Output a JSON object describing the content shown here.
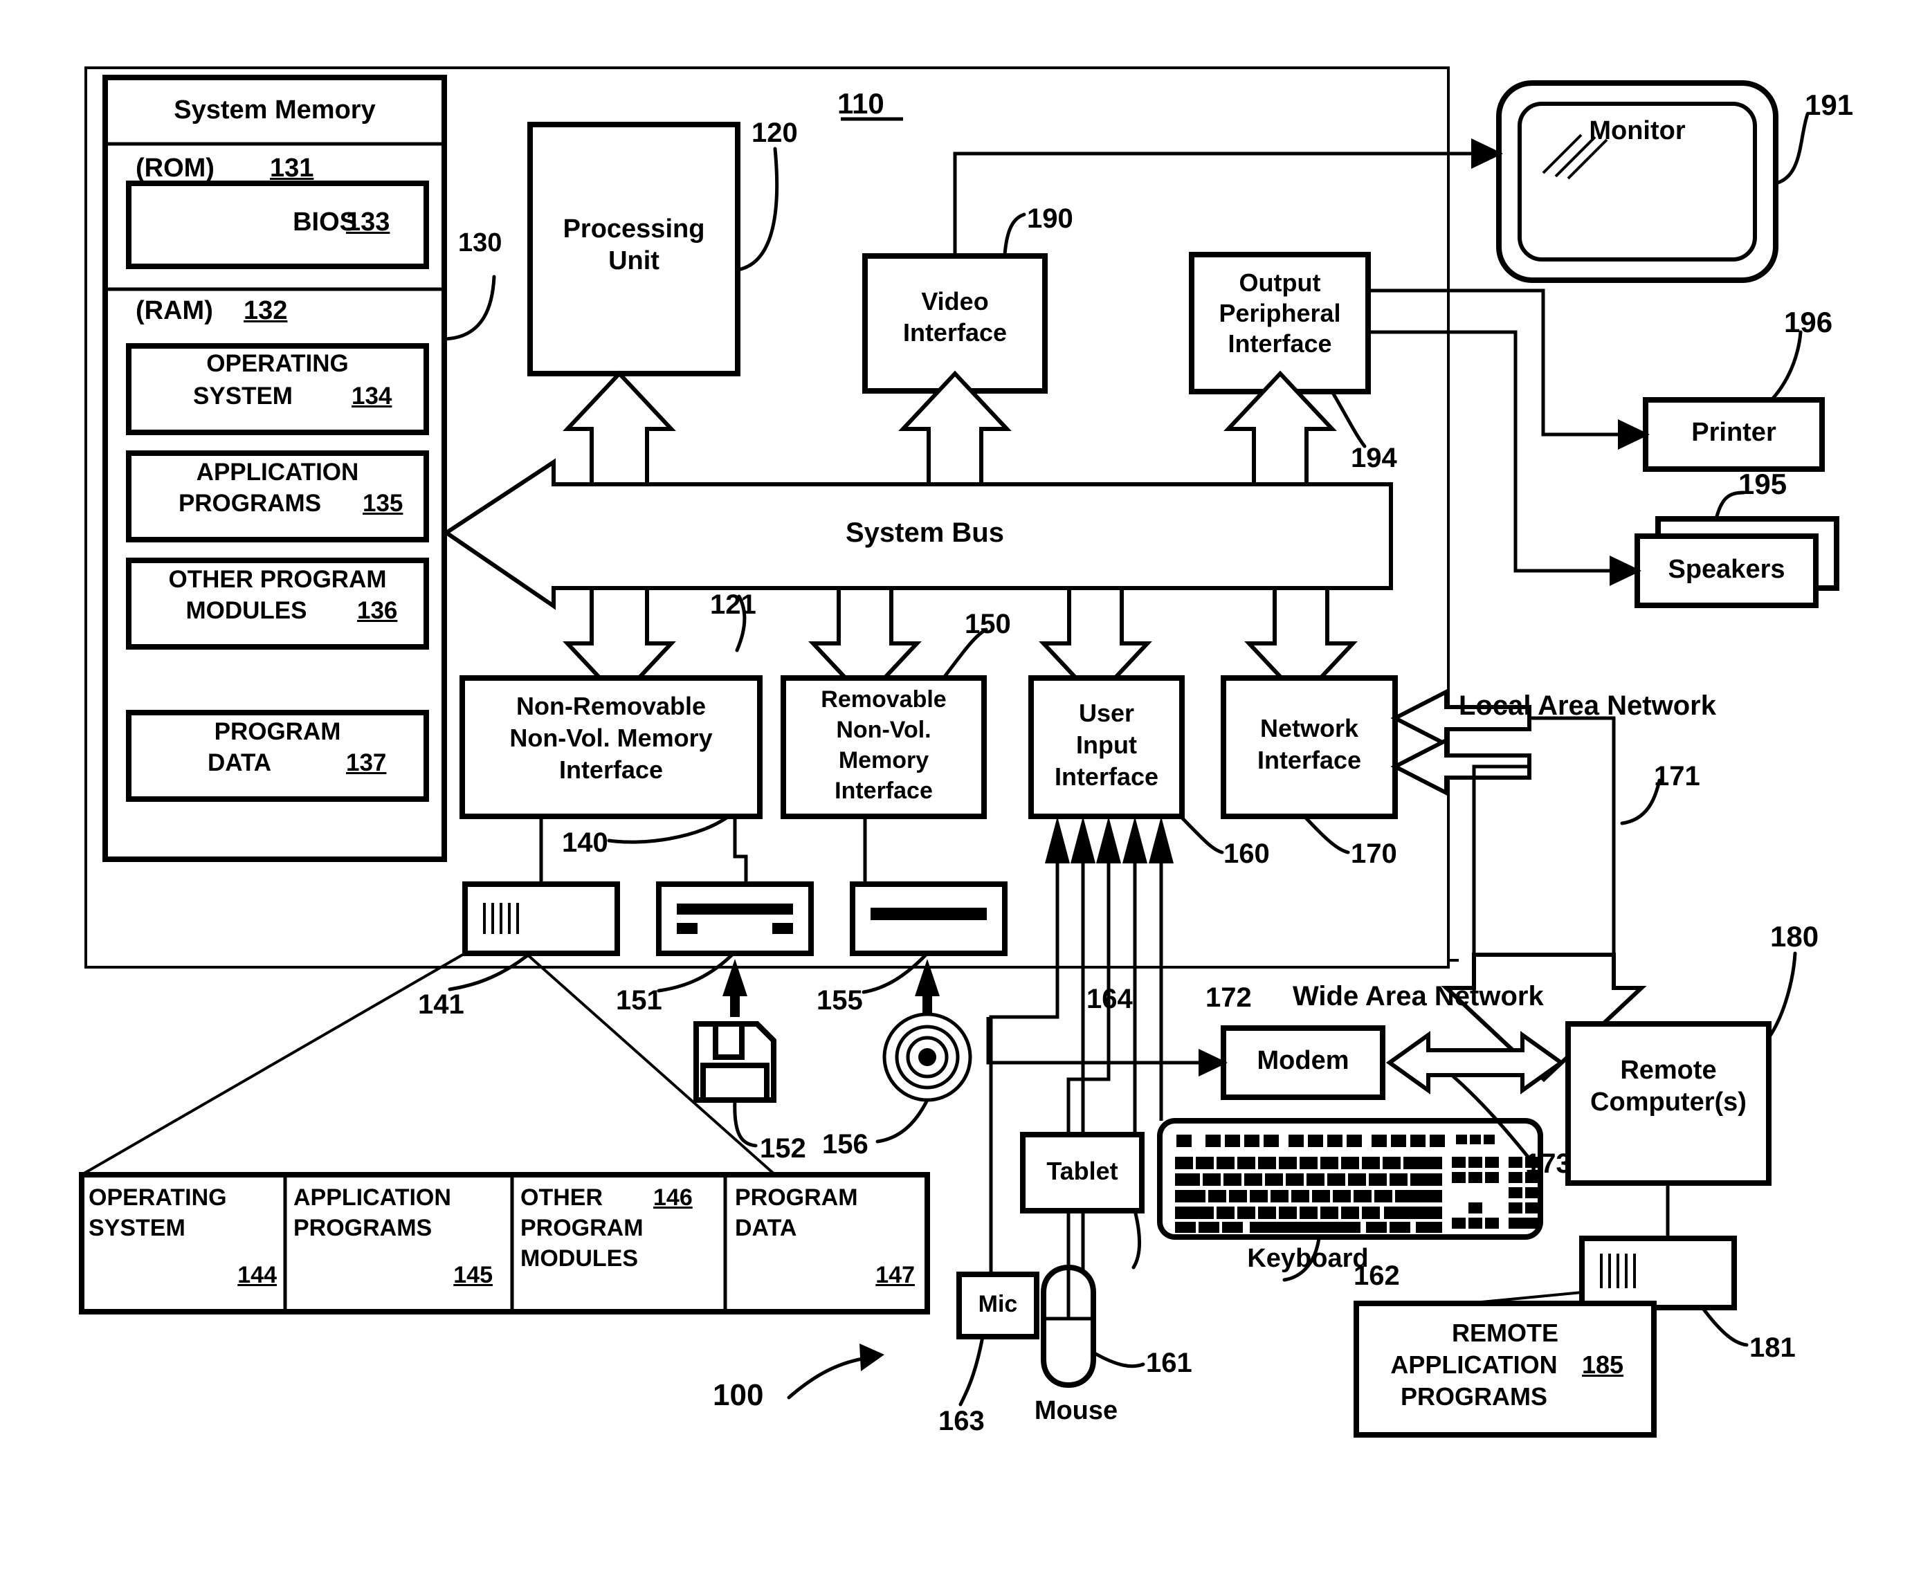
{
  "figure": {
    "title_number": "100",
    "system_number": "110"
  },
  "system_memory": {
    "title": "System Memory",
    "rom_label": "(ROM)",
    "rom_number": "131",
    "bios_label": "BIOS",
    "bios_number": "133",
    "ram_label": "(RAM)",
    "ram_number": "132",
    "items": [
      {
        "line1": "OPERATING",
        "line2": "SYSTEM",
        "number": "134"
      },
      {
        "line1": "APPLICATION",
        "line2": "PROGRAMS",
        "number": "135"
      },
      {
        "line1": "OTHER PROGRAM",
        "line2": "MODULES",
        "number": "136"
      },
      {
        "line1": "PROGRAM",
        "line2": "DATA",
        "number": "137"
      }
    ],
    "ref_number": "130"
  },
  "processing_unit": {
    "line1": "Processing",
    "line2": "Unit",
    "number": "120"
  },
  "bus": {
    "label": "System Bus",
    "number": "121"
  },
  "video_interface": {
    "line1": "Video",
    "line2": "Interface",
    "number": "190"
  },
  "output_peripheral_interface": {
    "line1": "Output",
    "line2": "Peripheral",
    "line3": "Interface",
    "number": "194"
  },
  "monitor": {
    "label": "Monitor",
    "number": "191"
  },
  "printer": {
    "label": "Printer",
    "number": "196"
  },
  "speakers": {
    "label": "Speakers",
    "number": "195"
  },
  "interfaces": {
    "non_removable": {
      "line1": "Non-Removable",
      "line2": "Non-Vol. Memory",
      "line3": "Interface",
      "number": "140"
    },
    "removable": {
      "line1": "Removable",
      "line2": "Non-Vol.",
      "line3": "Memory",
      "line4": "Interface",
      "number": "150"
    },
    "user_input": {
      "line1": "User",
      "line2": "Input",
      "line3": "Interface",
      "number": "160"
    },
    "network": {
      "line1": "Network",
      "line2": "Interface",
      "number": "170"
    }
  },
  "drives": {
    "hard_disk_number": "141",
    "floppy_drive_number": "151",
    "floppy_disk_number": "152",
    "optical_drive_number": "155",
    "optical_disc_number": "156"
  },
  "storage_contents": [
    {
      "line1": "OPERATING",
      "line2": "SYSTEM",
      "number": "144"
    },
    {
      "line1": "APPLICATION",
      "line2": "PROGRAMS",
      "number": "145"
    },
    {
      "line1": "OTHER",
      "line2": "PROGRAM",
      "line3": "MODULES",
      "number": "146"
    },
    {
      "line1": "PROGRAM",
      "line2": "DATA",
      "number": "147"
    }
  ],
  "input_devices": {
    "mic": {
      "label": "Mic",
      "number": "163"
    },
    "mouse": {
      "label": "Mouse",
      "number": "161"
    },
    "keyboard": {
      "label": "Keyboard",
      "number": "162"
    },
    "tablet": {
      "label": "Tablet",
      "number": "164"
    }
  },
  "network": {
    "lan_label": "Local Area Network",
    "lan_number": "171",
    "wan_label": "Wide Area Network",
    "wan_number": "173",
    "modem": {
      "label": "Modem",
      "number": "172"
    },
    "remote_computer": {
      "line1": "Remote",
      "line2": "Computer(s)",
      "number": "180"
    },
    "remote_storage_number": "181",
    "remote_apps": {
      "line1": "REMOTE",
      "line2": "APPLICATION",
      "line3": "PROGRAMS",
      "number": "185"
    }
  },
  "colors": {
    "ink": "#000000",
    "paper": "#ffffff"
  }
}
